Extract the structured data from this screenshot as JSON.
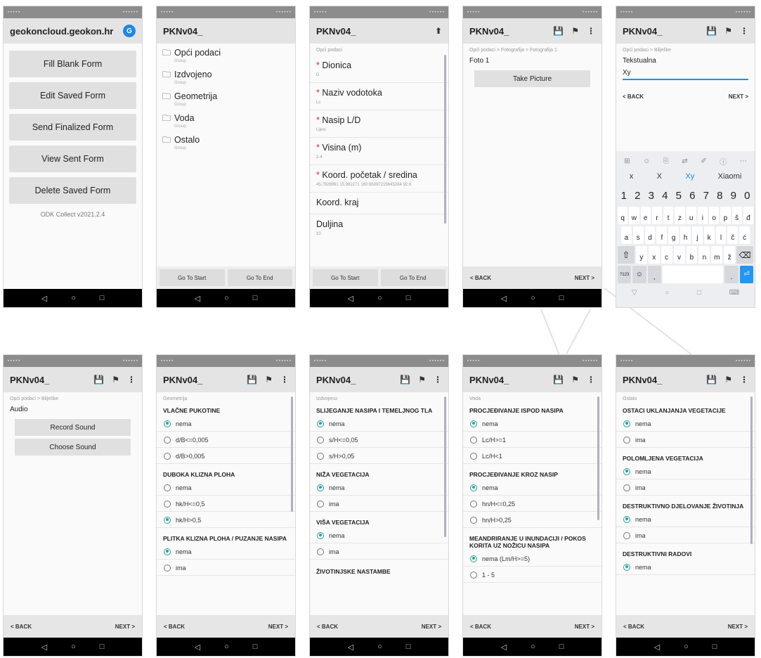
{
  "status_bar": {
    "left": "• • • • •",
    "right": "• • • • • •"
  },
  "nav_bar": {
    "back": "◁",
    "home": "○",
    "recent": "□"
  },
  "icons": {
    "save": "save-icon",
    "flag": "flag-icon",
    "more": "more-vert-icon",
    "up": "arrow-up-icon",
    "folder": "folder-icon"
  },
  "screens": {
    "home": {
      "title": "geokoncloud.geokon.hr",
      "avatar": "G",
      "buttons": [
        "Fill Blank Form",
        "Edit Saved Form",
        "Send Finalized Form",
        "View Sent Form",
        "Delete Saved Form"
      ],
      "version": "ODK Collect v2021.2.4"
    },
    "groups": {
      "title": "PKNv04_",
      "items": [
        {
          "name": "Opći podaci",
          "sub": "Group"
        },
        {
          "name": "Izdvojeno",
          "sub": "Group"
        },
        {
          "name": "Geometrija",
          "sub": "Group"
        },
        {
          "name": "Voda",
          "sub": "Group"
        },
        {
          "name": "Ostalo",
          "sub": "Group"
        }
      ],
      "go_start": "Go To Start",
      "go_end": "Go To End"
    },
    "general": {
      "title": "PKNv04_",
      "breadcrumb": "Opći podaci",
      "questions": [
        {
          "required": "*",
          "label": "Dionica",
          "value": "D"
        },
        {
          "required": "*",
          "label": "Naziv vodotoka",
          "value": "Ls"
        },
        {
          "required": "*",
          "label": "Nasip L/D",
          "value": "Lijevi"
        },
        {
          "required": "*",
          "label": "Visina (m)",
          "value": "2-4"
        },
        {
          "required": "*",
          "label": "Koord. početak / sredina",
          "value": "45.7928991 15.982271 160.65097215645284 92.9"
        },
        {
          "required": "",
          "label": "Koord. kraj",
          "value": ""
        },
        {
          "required": "",
          "label": "Duljina",
          "value": "10"
        }
      ],
      "go_start": "Go To Start",
      "go_end": "Go To End"
    },
    "photo": {
      "title": "PKNv04_",
      "breadcrumb": "Opći podaci > Fotografija > Fotografija 1",
      "label": "Foto 1",
      "button": "Take Picture",
      "back": "< BACK",
      "next": "NEXT >"
    },
    "text": {
      "title": "PKNv04_",
      "breadcrumb": "Opći podaci > Bilješke",
      "label": "Tekstualna",
      "value": "Xy",
      "back": "< BACK",
      "next": "NEXT >",
      "keyboard": {
        "tools": [
          "⊞",
          "☺",
          "⎘",
          "⇄",
          "✐",
          "ⓘ",
          "⋯"
        ],
        "suggestions": [
          "x",
          "X",
          "Xy",
          "Xiaomi"
        ],
        "numbers": [
          "1",
          "2",
          "3",
          "4",
          "5",
          "6",
          "7",
          "8",
          "9",
          "0"
        ],
        "row1": [
          "q",
          "w",
          "e",
          "r",
          "t",
          "z",
          "u",
          "i",
          "o",
          "p",
          "š",
          "đ"
        ],
        "row2": [
          "a",
          "s",
          "d",
          "f",
          "g",
          "h",
          "j",
          "k",
          "l",
          "č",
          "ć"
        ],
        "row3": [
          "y",
          "x",
          "c",
          "v",
          "b",
          "n",
          "m",
          "ž"
        ],
        "shift": "⇧",
        "backspace": "⌫",
        "sym": "?123",
        "emoji": "☺",
        "comma": ",",
        "space": "",
        "period": ".",
        "enter": "⏎",
        "nav": [
          "▽",
          "○",
          "□",
          "⌨"
        ]
      }
    },
    "audio": {
      "title": "PKNv04_",
      "breadcrumb": "Opći podaci > Bilješke",
      "label": "Audio",
      "record": "Record Sound",
      "choose": "Choose Sound",
      "back": "< BACK",
      "next": "NEXT >"
    },
    "geometry": {
      "title": "PKNv04_",
      "breadcrumb": "Geometrija",
      "sections": [
        {
          "q": "VLAČNE PUKOTINE",
          "options": [
            {
              "t": "nema",
              "sel": true
            },
            {
              "t": "d/B<=0,005",
              "sel": false
            },
            {
              "t": "d/B>0,005",
              "sel": false
            }
          ]
        },
        {
          "q": "DUBOKA KLIZNA PLOHA",
          "options": [
            {
              "t": "nema",
              "sel": false
            },
            {
              "t": "hk/H<=0,5",
              "sel": false
            },
            {
              "t": "hk/H>0,5",
              "sel": true
            }
          ]
        },
        {
          "q": "PLITKA KLIZNA PLOHA / PUZANJE NASIPA",
          "options": [
            {
              "t": "nema",
              "sel": true
            },
            {
              "t": "ima",
              "sel": false
            }
          ]
        }
      ],
      "back": "< BACK",
      "next": "NEXT >"
    },
    "separated": {
      "title": "PKNv04_",
      "breadcrumb": "Izdvojeno",
      "sections": [
        {
          "q": "SLIJEGANJE NASIPA I TEMELJNOG TLA",
          "options": [
            {
              "t": "nema",
              "sel": true
            },
            {
              "t": "s/H<=0,05",
              "sel": false
            },
            {
              "t": "s/H>0,05",
              "sel": false
            }
          ]
        },
        {
          "q": "NIŽA VEGETACIJA",
          "options": [
            {
              "t": "nema",
              "sel": true
            },
            {
              "t": "ima",
              "sel": false
            }
          ]
        },
        {
          "q": "VIŠA VEGETACIJA",
          "options": [
            {
              "t": "nema",
              "sel": true
            },
            {
              "t": "ima",
              "sel": false
            }
          ]
        },
        {
          "q": "ŽIVOTINJSKE NASTAMBE",
          "options": []
        }
      ],
      "back": "< BACK",
      "next": "NEXT >"
    },
    "water": {
      "title": "PKNv04_",
      "breadcrumb": "Voda",
      "sections": [
        {
          "q": "PROCJEĐIVANJE ISPOD NASIPA",
          "options": [
            {
              "t": "nema",
              "sel": true
            },
            {
              "t": "Lc/H>=1",
              "sel": false
            },
            {
              "t": "Lc/H<1",
              "sel": false
            }
          ]
        },
        {
          "q": "PROCJEĐIVANJE KROZ NASIP",
          "options": [
            {
              "t": "nema",
              "sel": true
            },
            {
              "t": "hn/H<=0,25",
              "sel": false
            },
            {
              "t": "hn/H>0,25",
              "sel": false
            }
          ]
        },
        {
          "q": "MEANDRIRANJE U INUNDACIJI / POKOS KORITA UZ NOŽICU NASIPA",
          "options": [
            {
              "t": "nema (Lm/H>=5)",
              "sel": true
            },
            {
              "t": "1 - 5",
              "sel": false
            }
          ]
        }
      ],
      "back": "< BACK",
      "next": "NEXT >"
    },
    "other": {
      "title": "PKNv04_",
      "breadcrumb": "Ostalo",
      "sections": [
        {
          "q": "OSTACI UKLANJANJA VEGETACIJE",
          "options": [
            {
              "t": "nema",
              "sel": true
            },
            {
              "t": "ima",
              "sel": false
            }
          ]
        },
        {
          "q": "POLOMLJENA VEGETACIJA",
          "options": [
            {
              "t": "nema",
              "sel": true
            },
            {
              "t": "ima",
              "sel": false
            }
          ]
        },
        {
          "q": "DESTRUKTIVNO DJELOVANJE ŽIVOTINJA",
          "options": [
            {
              "t": "nema",
              "sel": true
            },
            {
              "t": "ima",
              "sel": false
            }
          ]
        },
        {
          "q": "DESTRUKTIVNI RADOVI",
          "options": [
            {
              "t": "nema",
              "sel": true
            }
          ]
        }
      ],
      "back": "< BACK",
      "next": "NEXT >"
    }
  }
}
